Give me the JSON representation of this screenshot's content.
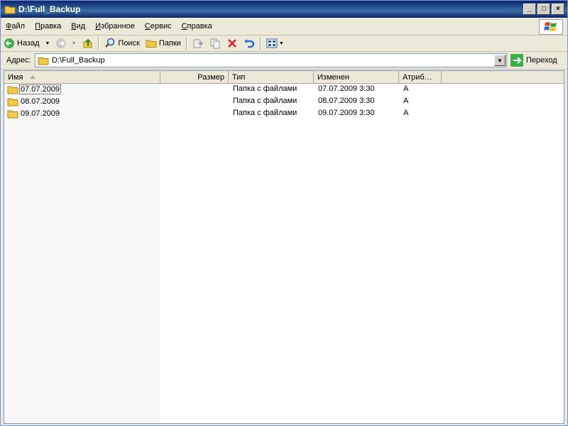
{
  "window": {
    "title": "D:\\Full_Backup",
    "buttons": [
      "_",
      "□",
      "×"
    ]
  },
  "menu": {
    "items": [
      {
        "u": "Ф",
        "rest": "айл"
      },
      {
        "u": "П",
        "rest": "равка"
      },
      {
        "u": "В",
        "rest": "ид"
      },
      {
        "u": "И",
        "rest": "збранное"
      },
      {
        "u": "С",
        "rest": "ервис"
      },
      {
        "u": "С",
        "rest": "правка"
      }
    ]
  },
  "toolbar": {
    "back_label": "Назад",
    "search_label": "Поиск",
    "folders_label": "Папки"
  },
  "address": {
    "label": "Адрес:",
    "value": "D:\\Full_Backup",
    "go_label": "Переход"
  },
  "columns": {
    "name": "Имя",
    "size": "Размер",
    "type": "Тип",
    "modified": "Изменен",
    "attributes": "Атриб…"
  },
  "files": [
    {
      "name": "07.07.2009",
      "size": "",
      "type": "Папка с файлами",
      "modified": "07.07.2009 3:30",
      "attr": "A"
    },
    {
      "name": "08.07.2009",
      "size": "",
      "type": "Папка с файлами",
      "modified": "08.07.2009 3:30",
      "attr": "A"
    },
    {
      "name": "09.07.2009",
      "size": "",
      "type": "Папка с файлами",
      "modified": "09.07.2009 3:30",
      "attr": "A"
    }
  ],
  "icons": {
    "folder": "folder-icon",
    "back": "back-arrow-icon",
    "forward": "forward-arrow-icon",
    "up": "folder-up-icon",
    "search": "search-icon",
    "folders": "folders-icon",
    "move": "move-to-icon",
    "copy": "copy-to-icon",
    "delete": "delete-icon",
    "undo": "undo-icon",
    "views": "views-icon",
    "go": "go-arrow-icon",
    "logo": "windows-logo-icon"
  },
  "colors": {
    "titlebar": "#0a246a",
    "selection": "#316ac5",
    "folder": "#f2c94c"
  }
}
